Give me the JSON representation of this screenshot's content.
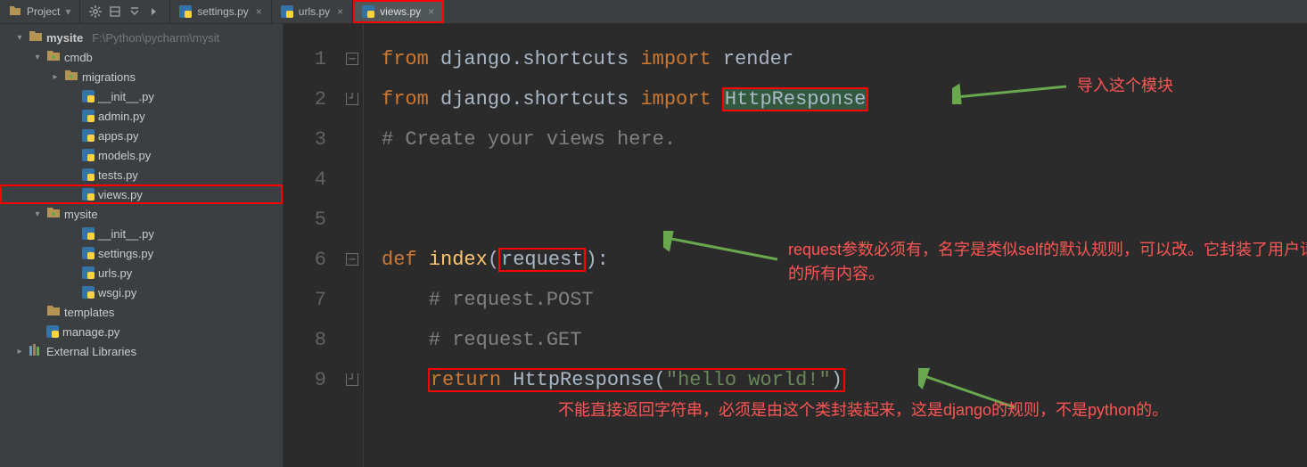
{
  "toolbar": {
    "project_label": "Project"
  },
  "tabs": [
    {
      "label": "settings.py"
    },
    {
      "label": "urls.py"
    },
    {
      "label": "views.py"
    }
  ],
  "tree": {
    "root_name": "mysite",
    "root_path": "F:\\Python\\pycharm\\mysit",
    "cmdb": "cmdb",
    "migrations": "migrations",
    "init": "__init__.py",
    "admin": "admin.py",
    "apps": "apps.py",
    "models": "models.py",
    "tests": "tests.py",
    "views": "views.py",
    "mysite_pkg": "mysite",
    "init2": "__init__.py",
    "settings": "settings.py",
    "urls": "urls.py",
    "wsgi": "wsgi.py",
    "templates": "templates",
    "manage": "manage.py",
    "ext_libs": "External Libraries"
  },
  "code": {
    "line_numbers": [
      "1",
      "2",
      "3",
      "4",
      "5",
      "6",
      "7",
      "8",
      "9"
    ],
    "l1a": "from",
    "l1b": " django.shortcuts ",
    "l1c": "import",
    "l1d": " render",
    "l2a": "from",
    "l2b": " django.shortcuts ",
    "l2c": "import",
    "l2d": " ",
    "l2e": "HttpResponse",
    "l3": "# Create your views here.",
    "l6a": "def ",
    "l6b": "index",
    "l6c": "(",
    "l6d": "request",
    "l6e": "):",
    "l7": "    # request.POST",
    "l8": "    # request.GET",
    "l9a": "    ",
    "l9b": "return",
    "l9c": " HttpResponse(",
    "l9d": "\"hello world!\"",
    "l9e": ")"
  },
  "annotations": {
    "a1": "导入这个模块",
    "a2": "request参数必须有，名字是类似self的默认规则，可以改。它封装了用户请求的所有内容。",
    "a3": "不能直接返回字符串，必须是由这个类封装起来，这是django的规则，不是python的。"
  }
}
